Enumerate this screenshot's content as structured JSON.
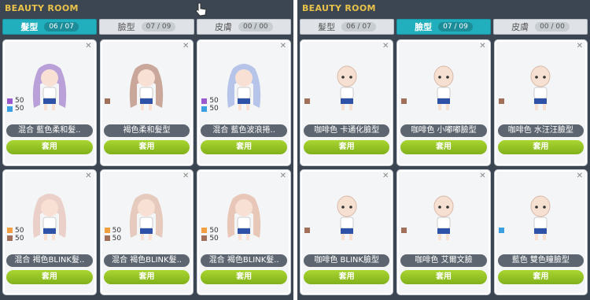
{
  "left_panel": {
    "title": "BEAUTY ROOM",
    "tabs": [
      {
        "label": "髮型",
        "count": "06 / 07",
        "active": true
      },
      {
        "label": "臉型",
        "count": "07 / 09",
        "active": false
      },
      {
        "label": "皮膚",
        "count": "00 / 00",
        "active": false
      }
    ],
    "cards": [
      {
        "name": "混合 藍色柔和髮..",
        "swatches": [
          {
            "color": "#9b59d0",
            "value": "50"
          },
          {
            "color": "#3aa0e0",
            "value": "50"
          }
        ],
        "apply": "套用",
        "hair": "#b9a0d8"
      },
      {
        "name": "褐色柔和髮型",
        "swatches": [
          {
            "color": "#a0705a",
            "value": ""
          }
        ],
        "apply": "套用",
        "hair": "#c9a79a"
      },
      {
        "name": "混合 藍色波浪捲..",
        "swatches": [
          {
            "color": "#9b59d0",
            "value": "50"
          },
          {
            "color": "#3aa0e0",
            "value": "50"
          }
        ],
        "apply": "套用",
        "hair": "#b7c4ea"
      },
      {
        "name": "混合 褐色BLINK髮..",
        "swatches": [
          {
            "color": "#f0a040",
            "value": "50"
          },
          {
            "color": "#a0705a",
            "value": "50"
          }
        ],
        "apply": "套用",
        "hair": "#ead0c8"
      },
      {
        "name": "混合 褐色BLINK髮..",
        "swatches": [
          {
            "color": "#f0a040",
            "value": "50"
          },
          {
            "color": "#a0705a",
            "value": "50"
          }
        ],
        "apply": "套用",
        "hair": "#e6cabd"
      },
      {
        "name": "混合 褐色BLINK髮..",
        "swatches": [
          {
            "color": "#f0a040",
            "value": "50"
          },
          {
            "color": "#a0705a",
            "value": "50"
          }
        ],
        "apply": "套用",
        "hair": "#e8c6b8"
      }
    ]
  },
  "right_panel": {
    "title": "BEAUTY ROOM",
    "tabs": [
      {
        "label": "髮型",
        "count": "06 / 07",
        "active": false
      },
      {
        "label": "臉型",
        "count": "07 / 09",
        "active": true
      },
      {
        "label": "皮膚",
        "count": "00 / 00",
        "active": false
      }
    ],
    "cards": [
      {
        "name": "咖啡色 卡通化臉型",
        "swatches": [
          {
            "color": "#a0705a",
            "value": ""
          }
        ],
        "apply": "套用",
        "hair": ""
      },
      {
        "name": "咖啡色 小嘟嘟臉型",
        "swatches": [
          {
            "color": "#a0705a",
            "value": ""
          }
        ],
        "apply": "套用",
        "hair": ""
      },
      {
        "name": "咖啡色 水汪汪臉型",
        "swatches": [
          {
            "color": "#a0705a",
            "value": ""
          }
        ],
        "apply": "套用",
        "hair": ""
      },
      {
        "name": "咖啡色 BLINK臉型",
        "swatches": [
          {
            "color": "#a0705a",
            "value": ""
          }
        ],
        "apply": "套用",
        "hair": ""
      },
      {
        "name": "咖啡色 艾爾文臉",
        "swatches": [
          {
            "color": "#a0705a",
            "value": ""
          }
        ],
        "apply": "套用",
        "hair": ""
      },
      {
        "name": "藍色 雙色瞳臉型",
        "swatches": [
          {
            "color": "#3aa0e0",
            "value": ""
          }
        ],
        "apply": "套用",
        "hair": ""
      }
    ]
  },
  "colors": {
    "accent": "#21aebd",
    "apply": "#8dbf22",
    "panel": "#3b4652",
    "title": "#e8c24a"
  }
}
